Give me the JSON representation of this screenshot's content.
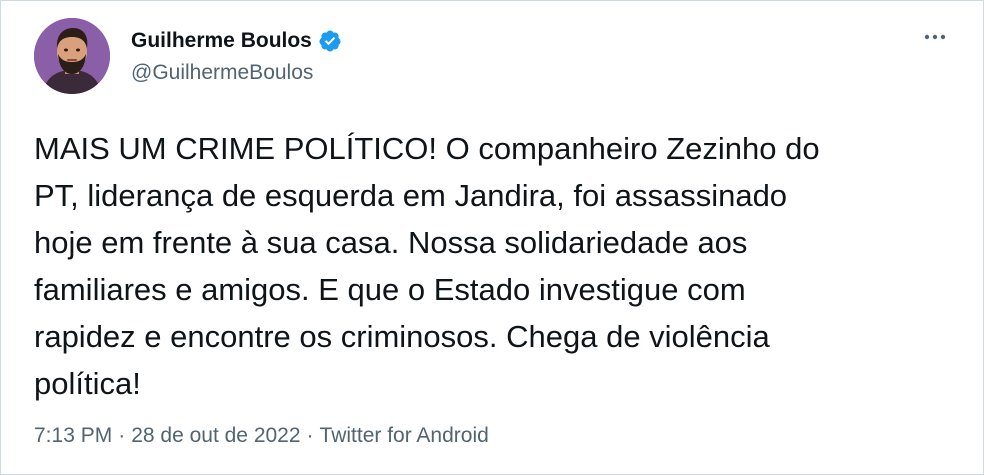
{
  "tweet": {
    "author": {
      "name": "Guilherme Boulos",
      "handle": "@GuilhermeBoulos",
      "verified": true
    },
    "text": "MAIS UM CRIME POLÍTICO! O companheiro Zezinho do\nPT, liderança de esquerda em Jandira, foi assassinado\nhoje em frente à sua casa. Nossa solidariedade aos\nfamiliares e amigos. E que o Estado investigue com\nrapidez e encontre os criminosos. Chega de violência\npolítica!",
    "time": "7:13 PM",
    "separator": "·",
    "date": "28 de out de 2022",
    "source": "Twitter for Android"
  },
  "icons": {
    "verified": "verified-badge-icon",
    "more": "more-options-icon"
  },
  "colors": {
    "text": "#0f1419",
    "secondary": "#536471",
    "verified": "#1d9bf0",
    "border": "#cfd9de",
    "avatar_bg": "#8a5fa8"
  }
}
